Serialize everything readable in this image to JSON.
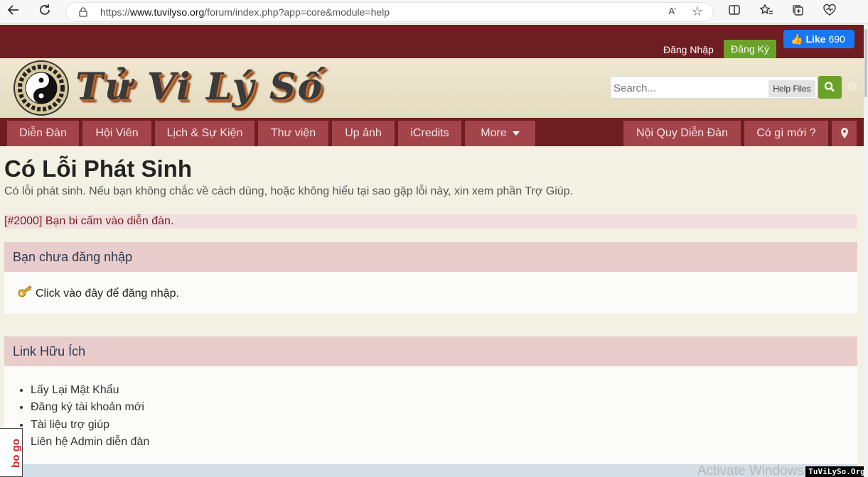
{
  "browser": {
    "url_prefix": "https://",
    "url_domain": "www.tuvilyso.org",
    "url_path": "/forum/index.php?app=core&module=help",
    "read_aloud": "A’"
  },
  "userbar": {
    "signin_label": "Đăng Nhập",
    "register_label": "Đăng Ký",
    "fb_like_label": "Like",
    "fb_like_count": "690"
  },
  "header": {
    "logo_text": "Tử Vi Lý Số",
    "search_placeholder": "Search...",
    "search_scope": "Help Files"
  },
  "nav": {
    "items": [
      "Diễn Đàn",
      "Hội Viên",
      "Lịch & Sự Kiện",
      "Thư viện",
      "Up ảnh",
      "iCredits",
      "More"
    ],
    "right_items": [
      "Nội Quy Diễn Đàn",
      "Có gì mới ?"
    ]
  },
  "content": {
    "title": "Có Lỗi Phát Sinh",
    "description": "Có lỗi phát sinh. Nếu bạn không chắc về cách dùng, hoặc không hiểu tại sao gặp lỗi này, xin xem phần Trợ Giúp.",
    "error": "[#2000] Bạn bi cấm vào diễn đàn.",
    "login_box": {
      "title": "Bạn chưa đăng nhập",
      "link": "Click vào đây để đăng nhập."
    },
    "links_box": {
      "title": "Link Hữu Ích",
      "links": [
        "Lấy Lại Mật Khẩu",
        "Đăng ký tài khoản mới",
        "Tài liệu trợ giúp",
        "Liên hệ Admin diễn đàn"
      ]
    }
  },
  "overlays": {
    "windows_watermark": "Activate Windows",
    "site_tag": "TuViLySo.Org",
    "side_logo": "bo go"
  },
  "colors": {
    "maroon": "#6e1d22",
    "nav_tab": "#a3444a",
    "green": "#6aa229",
    "box_header": "#e9cccc",
    "page_bg": "#f3f1e4"
  }
}
